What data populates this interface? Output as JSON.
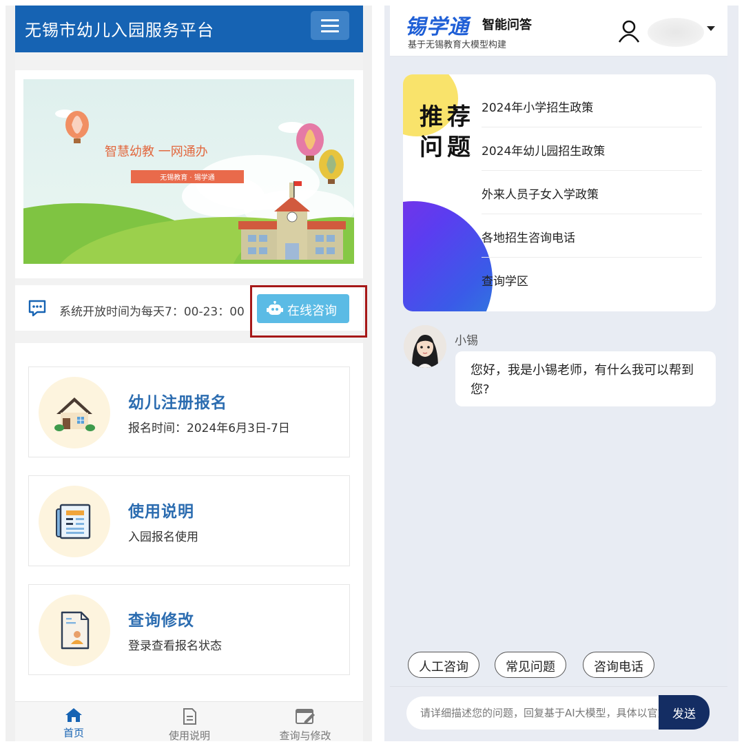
{
  "left": {
    "topbar": {
      "title": "无锡市幼儿入园服务平台"
    },
    "banner": {
      "slogan": "智慧幼教  一网通办",
      "ribbon": "无锡教育 · 锡学通"
    },
    "notice": {
      "text": "系统开放时间为每天7：00-23：00",
      "consult_label": "在线咨询"
    },
    "cards": [
      {
        "title": "幼儿注册报名",
        "subtitle": "报名时间：2024年6月3日-7日",
        "icon": "house-icon"
      },
      {
        "title": "使用说明",
        "subtitle": "入园报名使用",
        "icon": "document-icon"
      },
      {
        "title": "查询修改",
        "subtitle": "登录查看报名状态",
        "icon": "profile-doc-icon"
      }
    ],
    "nav": [
      {
        "label": "首页",
        "icon": "home-icon"
      },
      {
        "label": "使用说明",
        "icon": "doc-outline-icon"
      },
      {
        "label": "查询与修改",
        "icon": "edit-window-icon"
      }
    ]
  },
  "right": {
    "header": {
      "brand": "锡学通",
      "brand_sub": "智能问答",
      "desc": "基于无锡教育大模型构建"
    },
    "recommend": {
      "title": "推荐问题",
      "items": [
        "2024年小学招生政策",
        "2024年幼儿园招生政策",
        "外来人员子女入学政策",
        "各地招生咨询电话",
        "查询学区"
      ]
    },
    "chat": {
      "bot_name": "小锡",
      "greeting": "您好，我是小锡老师，有什么我可以帮到您?"
    },
    "quick_buttons": [
      "人工咨询",
      "常见问题",
      "咨询电话"
    ],
    "input": {
      "placeholder": "请详细描述您的问题，回复基于AI大模型，具体以官方为准",
      "send_label": "发送"
    }
  },
  "colors": {
    "primary": "#1663b3",
    "consult": "#5bbbe5",
    "highlight_box": "#a61818",
    "send": "#142d63",
    "brand": "#1f5fd6"
  }
}
